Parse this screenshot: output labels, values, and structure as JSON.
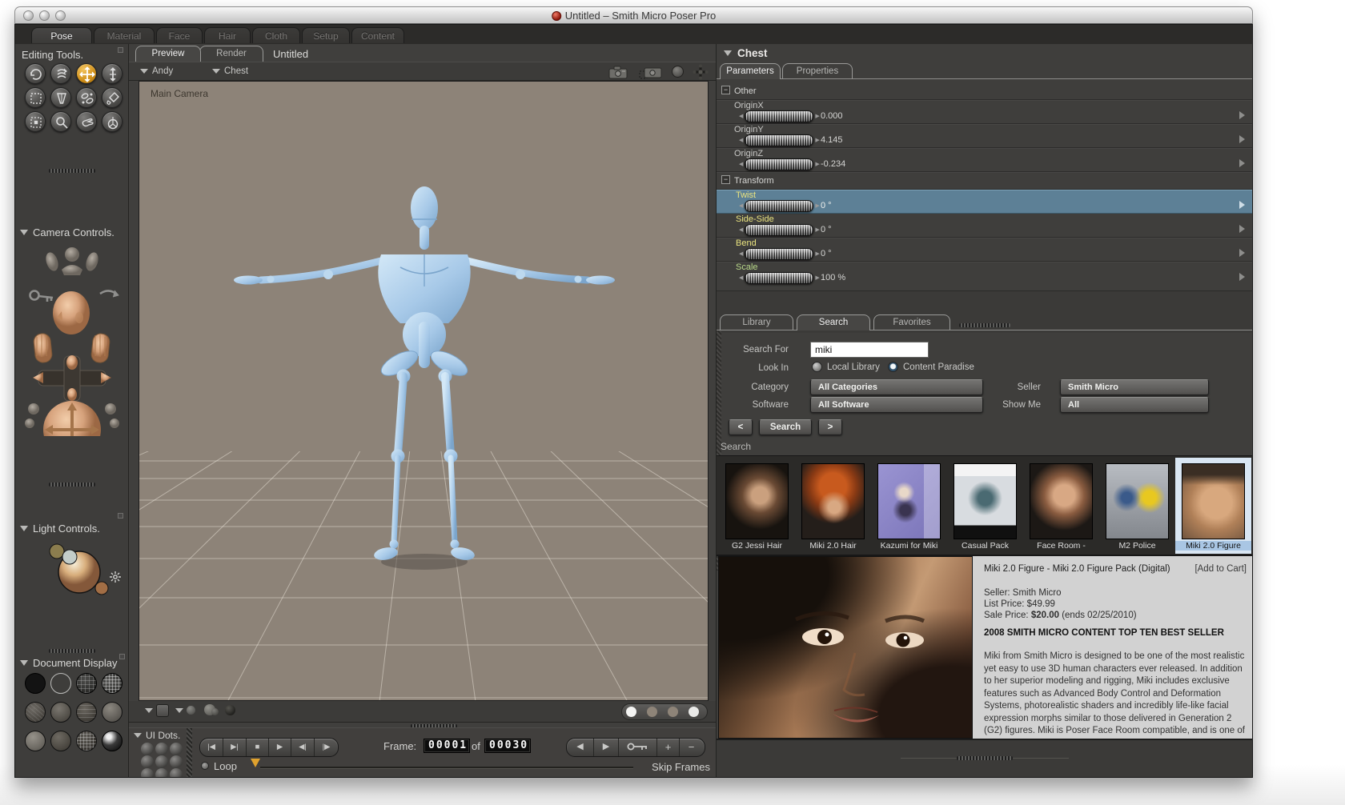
{
  "window": {
    "title": "Untitled – Smith Micro Poser Pro",
    "traffic_lights": [
      "close",
      "minimize",
      "zoom"
    ]
  },
  "main_tabs": {
    "items": [
      {
        "label": "Pose",
        "active": true
      },
      {
        "label": "Material"
      },
      {
        "label": "Face"
      },
      {
        "label": "Hair"
      },
      {
        "label": "Cloth"
      },
      {
        "label": "Setup"
      },
      {
        "label": "Content"
      }
    ]
  },
  "editing_tools": {
    "title": "Editing Tools.",
    "tools": [
      "rotate",
      "twist",
      "translate-pull",
      "translate-in-out",
      "scale",
      "taper",
      "chain-break",
      "color",
      "grouping",
      "view-magnifier",
      "morphing-tool",
      "direct-manipulation"
    ],
    "active_tool": "translate-pull",
    "accent_color": "#e0a22e"
  },
  "camera_controls": {
    "title": "Camera Controls."
  },
  "light_controls": {
    "title": "Light Controls."
  },
  "document_display": {
    "title": "Document Display"
  },
  "document": {
    "tabs": [
      {
        "label": "Preview",
        "active": true
      },
      {
        "label": "Render"
      }
    ],
    "title": "Untitled",
    "figure_selector": "Andy",
    "actor_selector": "Chest",
    "camera_label": "Main Camera",
    "viewport_icons": [
      "camera",
      "camera-select",
      "trackball",
      "four-way-jack"
    ],
    "ground_color": "#8d8378",
    "figure_color": "#a7c9e8"
  },
  "parameters": {
    "actor": "Chest",
    "tabs": [
      {
        "label": "Parameters",
        "active": true
      },
      {
        "label": "Properties"
      }
    ],
    "groups": [
      {
        "name": "Other",
        "params": [
          {
            "label": "OriginX",
            "value": "0.000"
          },
          {
            "label": "OriginY",
            "value": "4.145"
          },
          {
            "label": "OriginZ",
            "value": "-0.234"
          }
        ]
      },
      {
        "name": "Transform",
        "params": [
          {
            "label": "Twist",
            "value": "0 °",
            "selected": true
          },
          {
            "label": "Side-Side",
            "value": "0 °"
          },
          {
            "label": "Bend",
            "value": "0 °"
          },
          {
            "label": "Scale",
            "value": "100 %",
            "clipped": true
          }
        ]
      }
    ],
    "rotation_label_color": "#e9e37f",
    "scale_label_color": "#b9d98a",
    "selected_row_color": "#5d8096"
  },
  "library": {
    "tabs": [
      {
        "label": "Library"
      },
      {
        "label": "Search",
        "active": true
      },
      {
        "label": "Favorites"
      }
    ],
    "search_for_label": "Search For",
    "search_value": "miki",
    "look_in_label": "Look In",
    "look_in_options": [
      {
        "label": "Local Library",
        "selected": false
      },
      {
        "label": "Content Paradise",
        "selected": true
      }
    ],
    "category_label": "Category",
    "category_value": "All Categories",
    "seller_label": "Seller",
    "seller_value": "Smith Micro",
    "software_label": "Software",
    "software_value": "All Software",
    "show_me_label": "Show Me",
    "show_me_value": "All",
    "prev_button": "<",
    "search_button": "Search",
    "next_button": ">",
    "results_title": "Search"
  },
  "results": {
    "items": [
      {
        "label": "G2 Jessi Hair"
      },
      {
        "label": "Miki 2.0 Hair"
      },
      {
        "label": "Kazumi for Miki"
      },
      {
        "label": "Casual Pack"
      },
      {
        "label": "Face Room -"
      },
      {
        "label": "M2 Police"
      },
      {
        "label": "Miki 2.0 Figure",
        "selected": true
      }
    ],
    "selected_label_color": "#a9c6e4"
  },
  "product": {
    "title": "Miki 2.0 Figure - Miki 2.0 Figure Pack (Digital)",
    "add_to_cart": "[Add to Cart]",
    "seller": "Seller: Smith Micro",
    "list_price": "List Price: $49.99",
    "sale_price_label": "Sale Price:",
    "sale_price": "$20.00",
    "sale_price_note": "(ends 02/25/2010)",
    "headline": "2008 SMITH MICRO CONTENT TOP TEN BEST SELLER",
    "description": "Miki from Smith Micro is designed to be one of the most realistic yet easy to use 3D human characters ever released. In addition to her superior modeling and rigging, Miki includes exclusive features such as Advanced Body Control and Deformation Systems, photorealistic shaders and incredibly life-like facial expression morphs similar to those delivered in Generation 2 (G2) figures. Miki is Poser Face Room compatible, and is one of the most advanced and versatile Poser characters to date."
  },
  "animation": {
    "ui_dots_title": "UI Dots.",
    "transport": [
      {
        "name": "first-frame",
        "glyph": "|◀"
      },
      {
        "name": "end-frame",
        "glyph": "▶|"
      },
      {
        "name": "stop",
        "glyph": "■"
      },
      {
        "name": "play",
        "glyph": "▶"
      },
      {
        "name": "step-back",
        "glyph": "◀|"
      },
      {
        "name": "step-forward",
        "glyph": "|▶"
      }
    ],
    "frame_label": "Frame:",
    "frame_current": "00001",
    "frame_of_label": "of",
    "frame_total": "00030",
    "keyframe_buttons": [
      {
        "name": "prev-keyframe",
        "glyph": "◀"
      },
      {
        "name": "next-keyframe",
        "glyph": "▶"
      },
      {
        "name": "edit-keyframes"
      },
      {
        "name": "add-keyframe",
        "glyph": "+"
      },
      {
        "name": "delete-keyframe",
        "glyph": "−"
      }
    ],
    "loop_label": "Loop",
    "skip_frames_label": "Skip Frames",
    "playhead_color": "#e0a22e"
  }
}
